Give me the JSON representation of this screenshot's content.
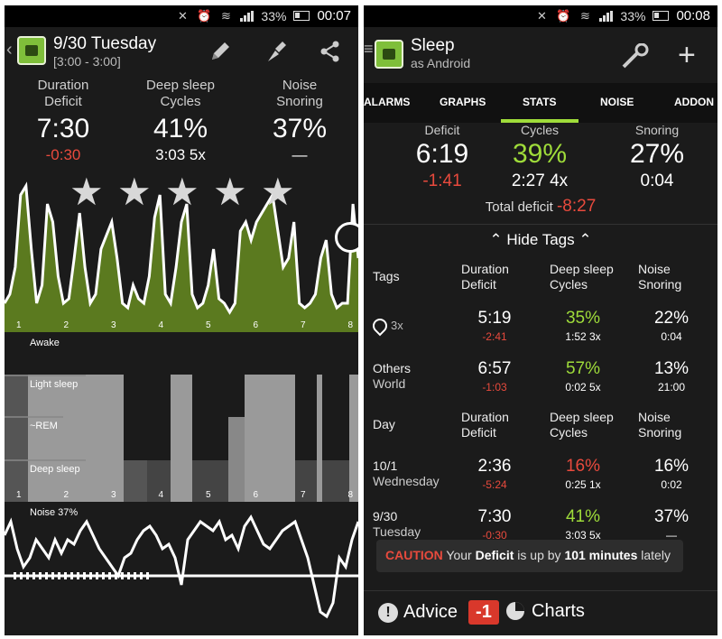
{
  "status": {
    "battery_pct": "33%",
    "time_left": "00:07",
    "time_right": "00:08"
  },
  "left": {
    "title": "9/30 Tuesday",
    "subtitle": "[3:00 - 3:00]",
    "stats": [
      {
        "h1": "Duration",
        "h2": "Deficit",
        "value": "7:30",
        "sub": "-0:30",
        "sub_color": "#e84a3d"
      },
      {
        "h1": "Deep sleep",
        "h2": "Cycles",
        "value": "41%",
        "sub": "3:03 5x",
        "sub_color": "#ffffff"
      },
      {
        "h1": "Noise",
        "h2": "Snoring",
        "value": "37%",
        "sub": "—",
        "sub_color": "#ffffff"
      }
    ],
    "rating_stars": 5,
    "hours": [
      "1",
      "2",
      "3",
      "4",
      "5",
      "6",
      "7",
      "8"
    ],
    "phases": {
      "awake": "Awake",
      "light": "Light sleep",
      "rem": "~REM",
      "deep": "Deep sleep"
    },
    "noise_label": "Noise 37%"
  },
  "right": {
    "title": "Sleep",
    "subtitle": "as Android",
    "tabs": [
      "ALARMS",
      "GRAPHS",
      "STATS",
      "NOISE",
      "ADDON"
    ],
    "active_tab": "STATS",
    "top_headers": [
      "Deficit",
      "Cycles",
      "Snoring"
    ],
    "top_values": [
      "6:19",
      "39%",
      "27%"
    ],
    "top_subs": [
      "-1:41",
      "2:27 4x",
      "0:04"
    ],
    "total_deficit_label": "Total deficit",
    "total_deficit_value": "-8:27",
    "hide_tags": "Hide Tags",
    "col_headers": [
      [
        "Duration",
        "Deficit"
      ],
      [
        "Deep sleep",
        "Cycles"
      ],
      [
        "Noise",
        "Snoring"
      ]
    ],
    "tags_label": "Tags",
    "day_label": "Day",
    "tag_rows": [
      {
        "label1": "3x",
        "label2": "",
        "home_icon": true,
        "c1": "5:19",
        "c1s": "-2:41",
        "c2": "35%",
        "c2s": "1:52 3x",
        "c3": "22%",
        "c3s": "0:04",
        "c2color": "#9fdc3a"
      },
      {
        "label1": "Others",
        "label2": "World",
        "home_icon": false,
        "c1": "6:57",
        "c1s": "-1:03",
        "c2": "57%",
        "c2s": "0:02 5x",
        "c3": "13%",
        "c3s": "21:00",
        "c2color": "#9fdc3a"
      }
    ],
    "day_rows": [
      {
        "label1": "10/1",
        "label2": "Wednesday",
        "c1": "2:36",
        "c1s": "-5:24",
        "c2": "16%",
        "c2s": "0:25 1x",
        "c3": "16%",
        "c3s": "0:02",
        "c2color": "#e84a3d"
      },
      {
        "label1": "9/30",
        "label2": "Tuesday",
        "c1": "7:30",
        "c1s": "-0:30",
        "c2": "41%",
        "c2s": "3:03 5x",
        "c3": "37%",
        "c3s": "—",
        "c2color": "#9fdc3a"
      }
    ],
    "toast": {
      "caution": "CAUTION",
      "t1": "Your",
      "deficit": "Deficit",
      "t2": "is up by",
      "minutes": "101 minutes",
      "t3": "lately"
    },
    "bottom": {
      "advice": "Advice",
      "badge": "-1",
      "charts": "Charts"
    }
  }
}
